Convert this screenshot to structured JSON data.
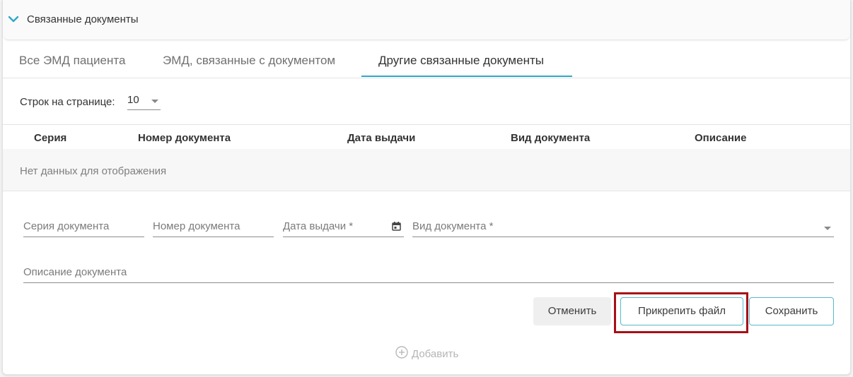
{
  "section": {
    "title": "Связанные документы",
    "chevron_icon": "chevron-down-icon"
  },
  "tabs": [
    {
      "label": "Все ЭМД пациента",
      "active": false
    },
    {
      "label": "ЭМД, связанные с документом",
      "active": false
    },
    {
      "label": "Другие связанные документы",
      "active": true
    }
  ],
  "pagination": {
    "rows_label": "Строк на странице:",
    "rows_value": "10"
  },
  "table": {
    "columns": [
      "Серия",
      "Номер документа",
      "Дата выдачи",
      "Вид документа",
      "Описание"
    ],
    "empty_text": "Нет данных для отображения"
  },
  "form": {
    "series_label": "Серия документа",
    "number_label": "Номер документа",
    "date_label": "Дата выдачи *",
    "type_label": "Вид документа *",
    "description_label": "Описание документа"
  },
  "buttons": {
    "cancel": "Отменить",
    "attach": "Прикрепить файл",
    "save": "Сохранить",
    "add": "Добавить"
  },
  "colors": {
    "accent": "#2ea8c7",
    "button_border": "#56b9cc",
    "highlight": "#a70f18"
  }
}
